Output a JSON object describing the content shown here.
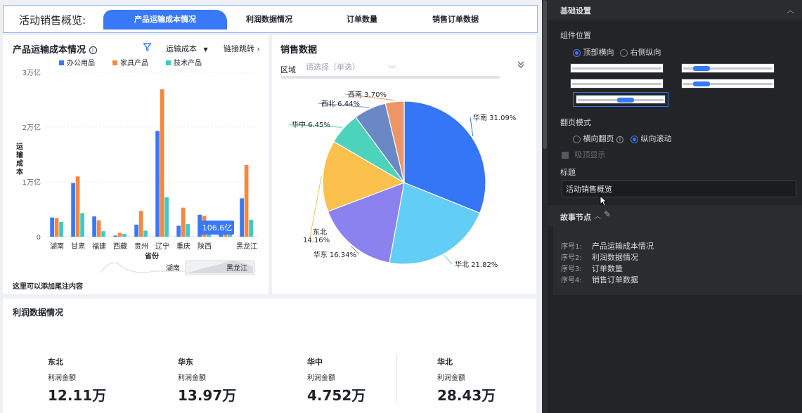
{
  "story": {
    "title": "活动销售概览:",
    "tabs": [
      "产品运输成本情况",
      "利润数据情况",
      "订单数量",
      "销售订单数据"
    ],
    "active_tab": 0
  },
  "cost_card": {
    "title": "产品运输成本情况",
    "filter_label": "运输成本",
    "link_label": "链接跳转",
    "footer": "这里可以添加尾注内容",
    "tooltip": "106.6亿",
    "brush_labels": [
      "湖南",
      "黑龙江"
    ],
    "chart_data": {
      "type": "bar",
      "xlabel": "省份",
      "ylabel": "运输成本",
      "yticks": [
        "0",
        "1万亿",
        "2万亿",
        "3万亿"
      ],
      "ylim": [
        0,
        3
      ],
      "categories": [
        "湖南",
        "甘肃",
        "福建",
        "西藏",
        "贵州",
        "辽宁",
        "重庆",
        "陕西",
        "",
        "黑龙江"
      ],
      "legend_position": "top",
      "series": [
        {
          "name": "办公用品",
          "color": "#3978f6",
          "values": [
            0.35,
            0.98,
            0.37,
            0.02,
            0.22,
            1.93,
            0.2,
            0.4,
            0.1,
            0.7
          ]
        },
        {
          "name": "家具产品",
          "color": "#f5883e",
          "values": [
            0.34,
            1.1,
            0.3,
            0.07,
            0.47,
            2.69,
            0.53,
            0.38,
            0.05,
            1.31
          ]
        },
        {
          "name": "技术产品",
          "color": "#3ccbc4",
          "values": [
            0.27,
            0.43,
            0.1,
            0.05,
            0.11,
            0.72,
            0.23,
            0.25,
            0.05,
            0.31
          ]
        }
      ]
    }
  },
  "sales_card": {
    "title": "销售数据",
    "region_label": "区域",
    "region_placeholder": "请选择（单选）",
    "chart_data": {
      "type": "pie",
      "slices": [
        {
          "name": "华南",
          "value": 31.09,
          "label": "华南 31.09%",
          "color": "#3476f5"
        },
        {
          "name": "华北",
          "value": 21.82,
          "label": "华北 21.82%",
          "color": "#62cdf6"
        },
        {
          "name": "华东",
          "value": 16.34,
          "label": "华东 16.34%",
          "color": "#8b82ef"
        },
        {
          "name": "东北",
          "value": 14.16,
          "label": "东北 14.16%",
          "color": "#fcc04c"
        },
        {
          "name": "华中",
          "value": 6.45,
          "label": "华中 6.45%",
          "color": "#4dd3bb"
        },
        {
          "name": "西北",
          "value": 6.44,
          "label": "西北 6.44%",
          "color": "#6a87c6"
        },
        {
          "name": "西南",
          "value": 3.7,
          "label": "西南 3.70%",
          "color": "#ec9566"
        }
      ]
    }
  },
  "profit_card": {
    "title": "利润数据情况",
    "items": [
      {
        "region": "东北",
        "label": "利润金额",
        "value": "12.11万"
      },
      {
        "region": "华东",
        "label": "利润金额",
        "value": "13.97万"
      },
      {
        "region": "华中",
        "label": "利润金额",
        "value": "4.752万"
      },
      {
        "region": "华北",
        "label": "利润金额",
        "value": "28.43万"
      }
    ]
  },
  "panel": {
    "section_title": "基础设置",
    "position_label": "组件位置",
    "position_options": [
      "顶部横向",
      "右侧纵向"
    ],
    "page_mode_label": "翻页模式",
    "page_mode_options": [
      "横向翻页",
      "纵向滚动"
    ],
    "sticky_label": "吸顶显示",
    "title_label": "标题",
    "title_value": "活动销售概览",
    "story_nodes_label": "故事节点",
    "nodes": [
      {
        "index": "序号1:",
        "name": "产品运输成本情况"
      },
      {
        "index": "序号2:",
        "name": "利润数据情况"
      },
      {
        "index": "序号3:",
        "name": "订单数量"
      },
      {
        "index": "序号4:",
        "name": "销售订单数据"
      }
    ]
  }
}
